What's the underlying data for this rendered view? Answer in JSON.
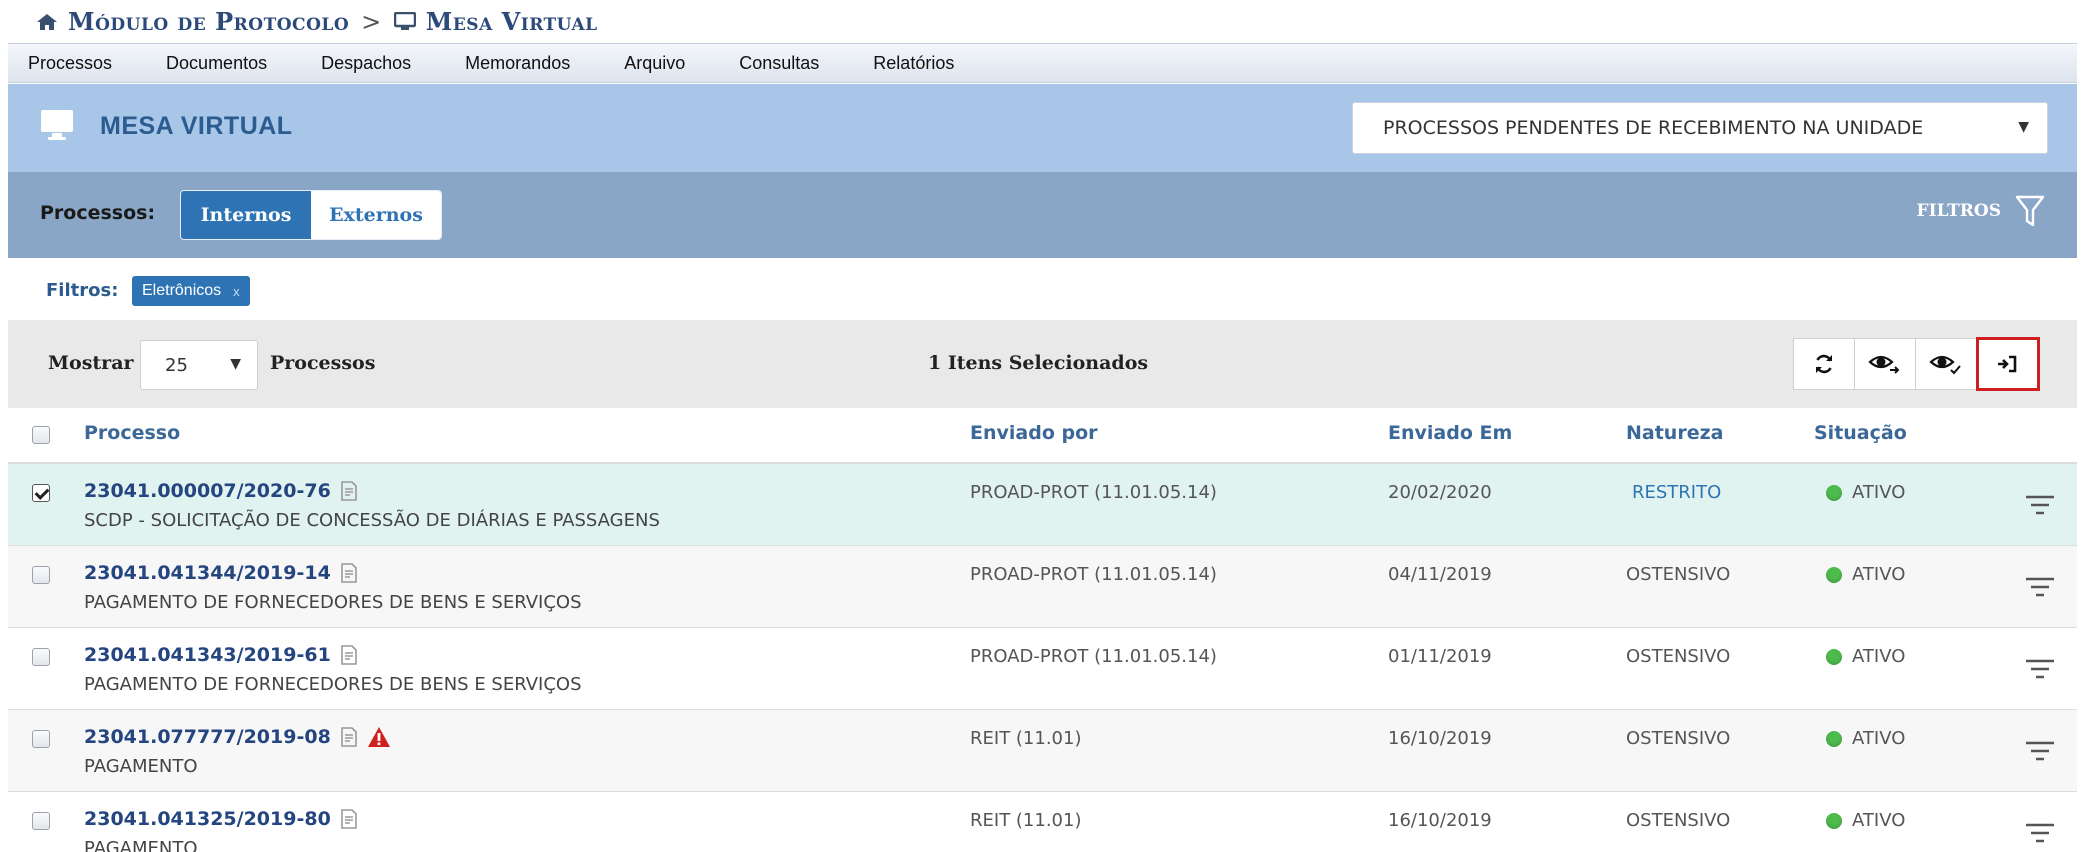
{
  "breadcrumb": {
    "module": "Módulo de Protocolo",
    "separator": ">",
    "current": "Mesa Virtual"
  },
  "menu": [
    "Processos",
    "Documentos",
    "Despachos",
    "Memorandos",
    "Arquivo",
    "Consultas",
    "Relatórios"
  ],
  "header": {
    "title": "MESA VIRTUAL",
    "select_value": "PROCESSOS PENDENTES DE RECEBIMENTO NA UNIDADE"
  },
  "processes_toggle": {
    "label": "Processos:",
    "options": [
      "Internos",
      "Externos"
    ],
    "active": "Internos",
    "filters_label": "FILTROS"
  },
  "active_filters": {
    "label": "Filtros:",
    "chips": [
      {
        "text": "Eletrônicos",
        "remove": "x"
      }
    ]
  },
  "toolbar": {
    "show_label": "Mostrar",
    "page_size": "25",
    "page_size_suffix": "Processos",
    "selected_text": "1 Itens Selecionados",
    "actions": [
      "refresh-icon",
      "eye-forward-icon",
      "eye-check-icon",
      "receive-icon"
    ]
  },
  "table": {
    "columns": [
      "Processo",
      "Enviado por",
      "Enviado Em",
      "Natureza",
      "Situação"
    ],
    "rows": [
      {
        "number": "23041.000007/2020-76",
        "description": "SCDP - SOLICITAÇÃO DE CONCESSÃO DE DIÁRIAS E PASSAGENS",
        "sent_by": "PROAD-PROT (11.01.05.14)",
        "sent_at": "20/02/2020",
        "nature": "RESTRITO",
        "status": "ATIVO",
        "selected": true,
        "warning": false
      },
      {
        "number": "23041.041344/2019-14",
        "description": "PAGAMENTO DE FORNECEDORES DE BENS E SERVIÇOS",
        "sent_by": "PROAD-PROT (11.01.05.14)",
        "sent_at": "04/11/2019",
        "nature": "OSTENSIVO",
        "status": "ATIVO",
        "selected": false,
        "warning": false
      },
      {
        "number": "23041.041343/2019-61",
        "description": "PAGAMENTO DE FORNECEDORES DE BENS E SERVIÇOS",
        "sent_by": "PROAD-PROT (11.01.05.14)",
        "sent_at": "01/11/2019",
        "nature": "OSTENSIVO",
        "status": "ATIVO",
        "selected": false,
        "warning": false
      },
      {
        "number": "23041.077777/2019-08",
        "description": "PAGAMENTO",
        "sent_by": "REIT (11.01)",
        "sent_at": "16/10/2019",
        "nature": "OSTENSIVO",
        "status": "ATIVO",
        "selected": false,
        "warning": true
      },
      {
        "number": "23041.041325/2019-80",
        "description": "PAGAMENTO",
        "sent_by": "REIT (11.01)",
        "sent_at": "16/10/2019",
        "nature": "OSTENSIVO",
        "status": "ATIVO",
        "selected": false,
        "warning": false
      }
    ]
  },
  "colors": {
    "header_bg": "#a8c6e8",
    "toggle_band_bg": "#8aa6c6",
    "accent_blue": "#2e74b5",
    "selected_row_bg": "#e1f3f0",
    "status_green": "#4cbb4c",
    "warning_red": "#d01f1f",
    "highlight_border": "#d01f1f"
  }
}
